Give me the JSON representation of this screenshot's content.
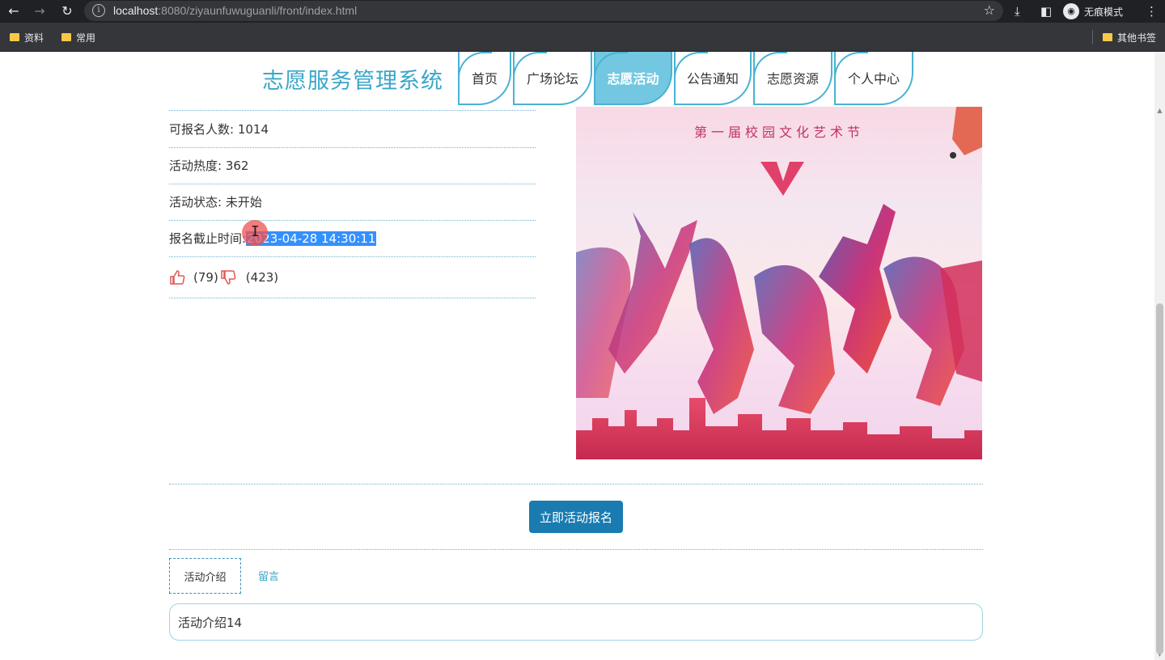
{
  "browser": {
    "url_host": "localhost",
    "url_rest": ":8080/ziyaunfuwuguanli/front/index.html",
    "incognito_label": "无痕模式",
    "bookmarks": [
      "资料",
      "常用"
    ],
    "other_bookmarks": "其他书签"
  },
  "site": {
    "title": "志愿服务管理系统",
    "nav": [
      "首页",
      "广场论坛",
      "志愿活动",
      "公告通知",
      "志愿资源",
      "个人中心"
    ],
    "active_nav": "志愿活动"
  },
  "details": {
    "capacity_label": "可报名人数:",
    "capacity_value": "1014",
    "heat_label": "活动热度:",
    "heat_value": "362",
    "status_label": "活动状态:",
    "status_value": "未开始",
    "deadline_label": "报名截止时间:",
    "deadline_value_tail": "2023-04-28 14:30:11",
    "likes": "(79)",
    "dislikes": "(423)"
  },
  "poster": {
    "title": "第一届校园文化艺术节"
  },
  "actions": {
    "signup_label": "立即活动报名"
  },
  "tabs": {
    "intro": "活动介绍",
    "message": "留言"
  },
  "intro_content": "活动介绍14",
  "colors": {
    "accent": "#3aa6c9",
    "nav_active": "#73c7e0",
    "button": "#1a7bb0",
    "selection": "#3390ff"
  }
}
